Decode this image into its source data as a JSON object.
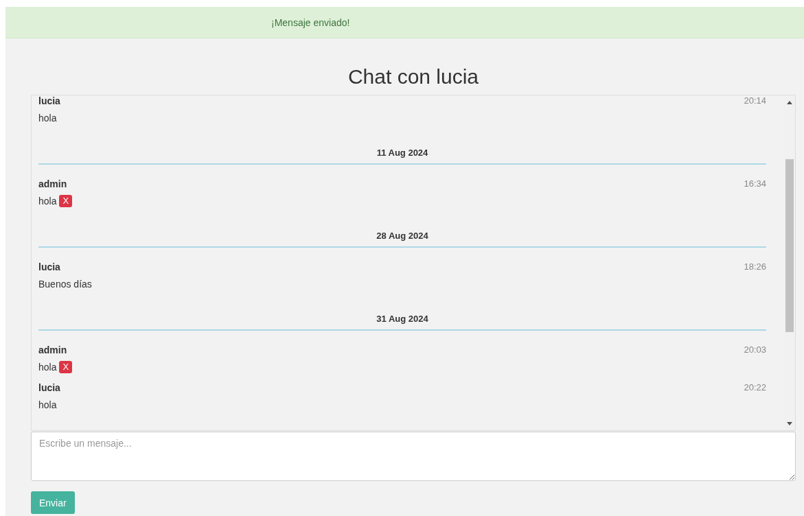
{
  "alert": {
    "text": "¡Mensaje enviado!"
  },
  "title": "Chat con lucia",
  "messages": [
    {
      "kind": "message",
      "sender": "lucia",
      "time": "20:14",
      "text": "hola",
      "deletable": false
    },
    {
      "kind": "date",
      "label": "11 Aug 2024"
    },
    {
      "kind": "message",
      "sender": "admin",
      "time": "16:34",
      "text": "hola",
      "deletable": true,
      "delete_label": "X"
    },
    {
      "kind": "date",
      "label": "28 Aug 2024"
    },
    {
      "kind": "message",
      "sender": "lucia",
      "time": "18:26",
      "text": "Buenos días",
      "deletable": false
    },
    {
      "kind": "date",
      "label": "31 Aug 2024"
    },
    {
      "kind": "message",
      "sender": "admin",
      "time": "20:03",
      "text": "hola",
      "deletable": true,
      "delete_label": "X"
    },
    {
      "kind": "message",
      "sender": "lucia",
      "time": "20:22",
      "text": "hola",
      "deletable": false
    }
  ],
  "composer": {
    "placeholder": "Escribe un mensaje..."
  },
  "send_button": "Enviar"
}
